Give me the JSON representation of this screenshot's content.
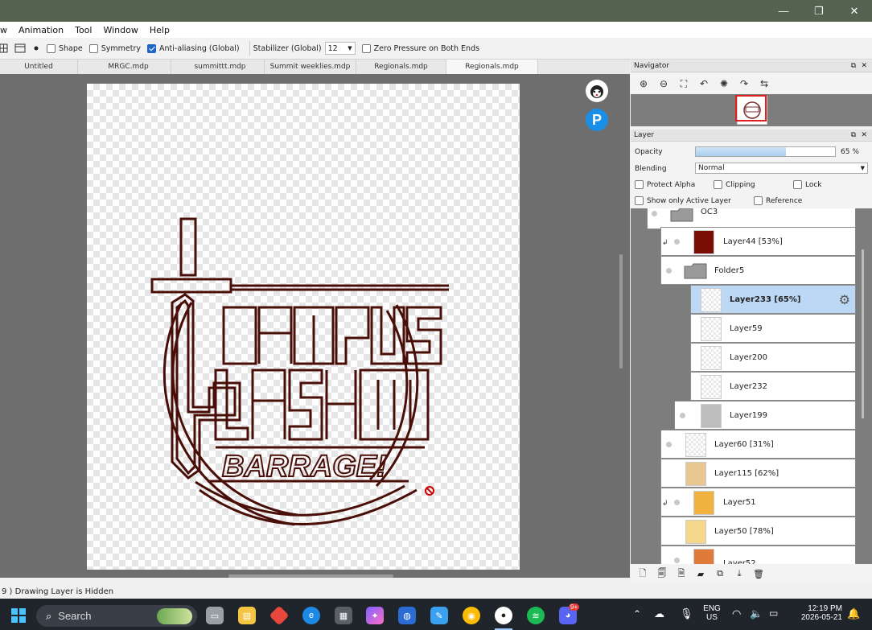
{
  "window": {
    "minimize": "—",
    "maximize": "❐",
    "close": "✕"
  },
  "menu": [
    "w",
    "Animation",
    "Tool",
    "Window",
    "Help"
  ],
  "toolbar": {
    "shape": "Shape",
    "symmetry": "Symmetry",
    "antialias": "Anti-aliasing (Global)",
    "stabilizer_label": "Stabilizer (Global)",
    "stabilizer_value": "12",
    "zero_pressure": "Zero Pressure on Both Ends"
  },
  "tabs": [
    "Untitled",
    "MRGC.mdp",
    "summittt.mdp",
    "Summit weeklies.mdp",
    "Regionals.mdp",
    "Regionals.mdp"
  ],
  "artwork": {
    "line1": "CAMPUS",
    "line2": "LASH",
    "numeral": "III",
    "line3": "BARRAGE!"
  },
  "status": "9 )  Drawing Layer is Hidden",
  "navigator": {
    "title": "Navigator"
  },
  "layer_panel": {
    "title": "Layer",
    "opacity_label": "Opacity",
    "opacity_value": 65,
    "opacity_text": "65 %",
    "blending_label": "Blending",
    "blending_value": "Normal",
    "protect_alpha": "Protect Alpha",
    "clipping": "Clipping",
    "lock": "Lock",
    "show_only_active": "Show only Active Layer",
    "reference": "Reference"
  },
  "layers": [
    {
      "name": "OC3",
      "type": "folder"
    },
    {
      "name": "Layer44 [53%]",
      "type": "layer"
    },
    {
      "name": "Folder5",
      "type": "folder"
    },
    {
      "name": "Layer233 [65%]",
      "type": "layer",
      "selected": true
    },
    {
      "name": "Layer59",
      "type": "layer"
    },
    {
      "name": "Layer200",
      "type": "layer"
    },
    {
      "name": "Layer232",
      "type": "layer"
    },
    {
      "name": "Layer199",
      "type": "layer"
    },
    {
      "name": "Layer60 [31%]",
      "type": "layer"
    },
    {
      "name": "Layer115 [62%]",
      "type": "layer"
    },
    {
      "name": "Layer51",
      "type": "layer"
    },
    {
      "name": "Layer50 [78%]",
      "type": "layer"
    },
    {
      "name": "Layer52",
      "type": "layer"
    }
  ],
  "taskbar": {
    "search": "Search",
    "lang_top": "ENG",
    "lang_bottom": "US",
    "time": "12:19 PM",
    "date": "2026-05-21",
    "discord_badge": "9+"
  },
  "colors": {
    "titlebar": "#53634f",
    "logo_stroke": "#4a0e08",
    "selection": "#bcd8f4",
    "accent": "#2266cc"
  }
}
